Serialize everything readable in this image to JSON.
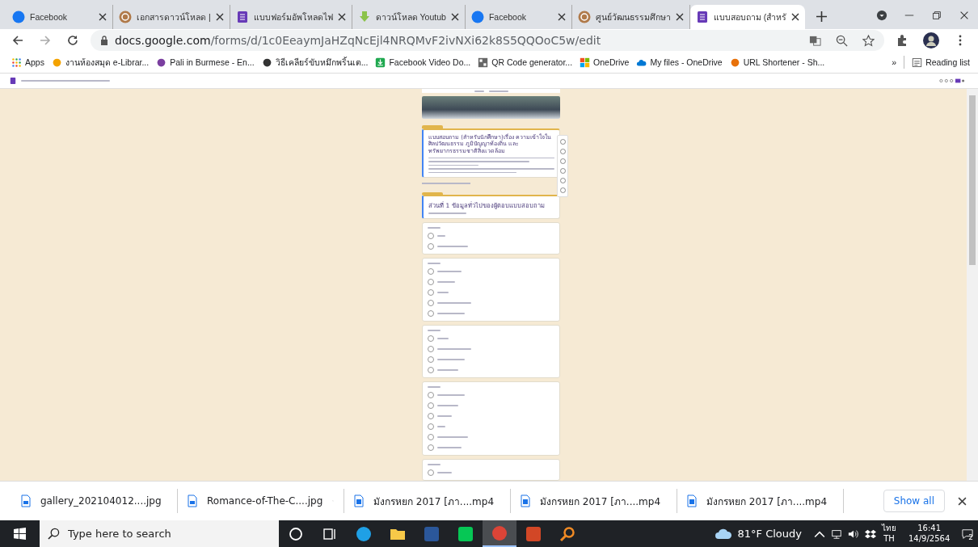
{
  "tabs": [
    {
      "kind": "facebook",
      "label": "Facebook",
      "selected": false
    },
    {
      "kind": "circle",
      "label": "เอกสารดาวน์โหลด |",
      "selected": false
    },
    {
      "kind": "form",
      "label": "แบบฟอร์มอัพโหลดไฟ",
      "selected": false
    },
    {
      "kind": "download",
      "label": "ดาวน์โหลด Youtub",
      "selected": false
    },
    {
      "kind": "facebook",
      "label": "Facebook",
      "selected": false
    },
    {
      "kind": "circle",
      "label": "ศูนย์วัฒนธรรมศึกษา",
      "selected": false
    },
    {
      "kind": "form",
      "label": "แบบสอบถาม (สำหรั",
      "selected": true
    }
  ],
  "address": {
    "domain": "docs.google.com",
    "path": "/forms/d/1c0EeaymJaHZqNcEjl4NRQMvF2ivNXi62k8S5QQOoC5w/edit"
  },
  "bookmarks": [
    {
      "kind": "apps",
      "label": "Apps"
    },
    {
      "kind": "lib",
      "label": "งานห้องสมุด e-Librar..."
    },
    {
      "kind": "pali",
      "label": "Pali in Burmese - En..."
    },
    {
      "kind": "printer",
      "label": "วิธีเคลียร์ขับหมึกพริ้นเต..."
    },
    {
      "kind": "download",
      "label": "Facebook Video Do..."
    },
    {
      "kind": "qr",
      "label": "QR Code generator..."
    },
    {
      "kind": "windows",
      "label": "OneDrive"
    },
    {
      "kind": "cloud",
      "label": "My files - OneDrive"
    },
    {
      "kind": "url",
      "label": "URL Shortener - Sh..."
    }
  ],
  "bookmarks_more": "»",
  "reading_list": "Reading list",
  "form": {
    "title": "แบบสอบถาม (สำหรับนักศึกษา)เรื่อง ความเข้าใจในศิลปวัฒนธรรม ภูมิปัญญาท้องถิ่น และทรัพยากรธรรมชาติสิ่งแวดล้อม",
    "section_title": "ส่วนที่ 1 ข้อมูลทั่วไปของผู้ตอบแบบสอบถาม",
    "questions": [
      {
        "options": [
          {
            "selected": false
          },
          {
            "selected": false
          }
        ]
      },
      {
        "options": [
          {
            "selected": false
          },
          {
            "selected": false
          },
          {
            "selected": false
          },
          {
            "selected": false
          },
          {
            "selected": false
          }
        ]
      },
      {
        "options": [
          {
            "selected": false
          },
          {
            "selected": false
          },
          {
            "selected": false
          },
          {
            "selected": false
          }
        ]
      },
      {
        "options": [
          {
            "selected": false
          },
          {
            "selected": false
          },
          {
            "selected": false
          },
          {
            "selected": false
          },
          {
            "selected": false
          },
          {
            "selected": false
          }
        ]
      },
      {
        "options": [
          {
            "selected": false
          }
        ]
      }
    ]
  },
  "downloads": [
    {
      "kind": "image",
      "name": "gallery_202104012....jpg"
    },
    {
      "kind": "image",
      "name": "Romance-of-The-C....jpg"
    },
    {
      "kind": "video",
      "name": "มังกรหยก 2017 [ภา....mp4"
    },
    {
      "kind": "video",
      "name": "มังกรหยก 2017 [ภา....mp4"
    },
    {
      "kind": "video",
      "name": "มังกรหยก 2017 [ภา....mp4"
    }
  ],
  "show_all": "Show all",
  "taskbar": {
    "search_placeholder": "Type here to search",
    "apps": [
      {
        "kind": "cortana",
        "selected": false
      },
      {
        "kind": "taskview",
        "selected": false
      },
      {
        "kind": "edge",
        "selected": false
      },
      {
        "kind": "explorer",
        "selected": false
      },
      {
        "kind": "word",
        "selected": false
      },
      {
        "kind": "line",
        "selected": false
      },
      {
        "kind": "chrome",
        "selected": true
      },
      {
        "kind": "powerpoint",
        "selected": false
      },
      {
        "kind": "search",
        "selected": false
      }
    ],
    "weather": "81°F  Cloudy",
    "language": "ไทย",
    "layout": "TH",
    "time": "16:41",
    "date": "14/9/2564",
    "notifications": "2"
  }
}
